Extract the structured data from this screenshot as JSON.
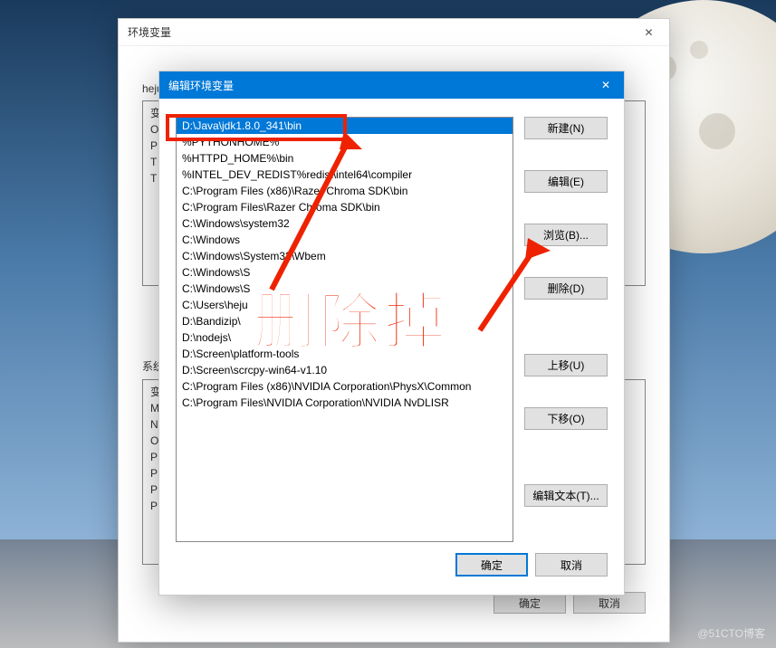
{
  "outer_dialog": {
    "title": "环境变量",
    "user_label": "heju...",
    "user_vars_visible": [
      "变",
      "O",
      "P",
      "T",
      "T"
    ],
    "system_label": "系统",
    "system_vars_visible": [
      "变",
      "M",
      "N",
      "O",
      "P",
      "P",
      "P",
      "P"
    ],
    "ok": "确定",
    "cancel": "取消"
  },
  "edit_dialog": {
    "title": "编辑环境变量",
    "paths": [
      "D:\\Java\\jdk1.8.0_341\\bin",
      "%PYTHONHOME%",
      "%HTTPD_HOME%\\bin",
      "%INTEL_DEV_REDIST%redist\\intel64\\compiler",
      "C:\\Program Files (x86)\\Razer Chroma SDK\\bin",
      "C:\\Program Files\\Razer Chroma SDK\\bin",
      "C:\\Windows\\system32",
      "C:\\Windows",
      "C:\\Windows\\System32\\Wbem",
      "C:\\Windows\\S",
      "C:\\Windows\\S",
      "C:\\Users\\heju",
      "D:\\Bandizip\\",
      "D:\\nodejs\\",
      "D:\\Screen\\platform-tools",
      "D:\\Screen\\scrcpy-win64-v1.10",
      "C:\\Program Files (x86)\\NVIDIA Corporation\\PhysX\\Common",
      "C:\\Program Files\\NVIDIA Corporation\\NVIDIA NvDLISR"
    ],
    "selected_index": 0,
    "buttons": {
      "new": "新建(N)",
      "edit": "编辑(E)",
      "browse": "浏览(B)...",
      "delete": "删除(D)",
      "up": "上移(U)",
      "down": "下移(O)",
      "edit_text": "编辑文本(T)...",
      "ok": "确定",
      "cancel": "取消"
    }
  },
  "annotation": {
    "big_text": "删除掉"
  },
  "watermark": "@51CTO博客"
}
